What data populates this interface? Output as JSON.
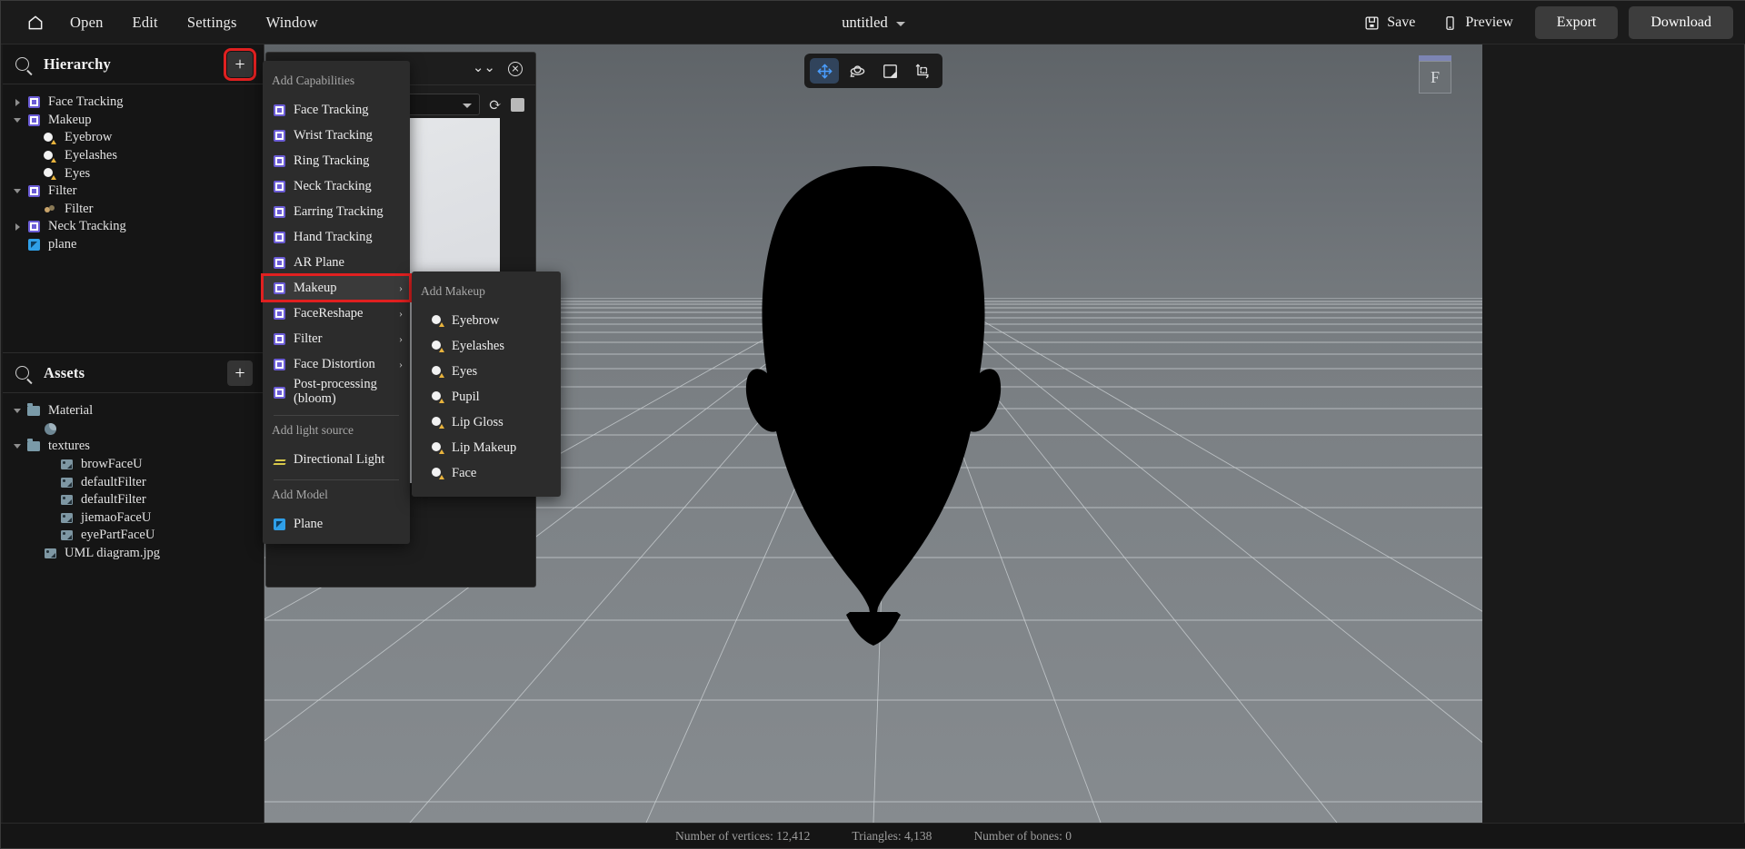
{
  "topbar": {
    "home_icon": "home-icon",
    "menus": [
      "Open",
      "Edit",
      "Settings",
      "Window"
    ],
    "doc_title": "untitled",
    "save_label": "Save",
    "preview_label": "Preview",
    "export_label": "Export",
    "download_label": "Download"
  },
  "hierarchy": {
    "title": "Hierarchy",
    "add_label": "+",
    "items": [
      {
        "label": "Face Tracking",
        "icon": "capability-icon",
        "indent": 0,
        "twisty": "right"
      },
      {
        "label": "Makeup",
        "icon": "capability-icon",
        "indent": 0,
        "twisty": "down"
      },
      {
        "label": "Eyebrow",
        "icon": "makeup-icon",
        "indent": 1,
        "twisty": "none"
      },
      {
        "label": "Eyelashes",
        "icon": "makeup-icon",
        "indent": 1,
        "twisty": "none"
      },
      {
        "label": "Eyes",
        "icon": "makeup-icon",
        "indent": 1,
        "twisty": "none"
      },
      {
        "label": "Filter",
        "icon": "capability-icon",
        "indent": 0,
        "twisty": "down"
      },
      {
        "label": "Filter",
        "icon": "filter-icon",
        "indent": 1,
        "twisty": "none"
      },
      {
        "label": "Neck Tracking",
        "icon": "capability-icon",
        "indent": 0,
        "twisty": "right"
      },
      {
        "label": "plane",
        "icon": "plane-icon",
        "indent": 0,
        "twisty": "none"
      }
    ]
  },
  "assets": {
    "title": "Assets",
    "add_label": "+",
    "items": [
      {
        "label": "Material",
        "icon": "folder-icon",
        "indent": 0,
        "twisty": "down"
      },
      {
        "label": "",
        "icon": "material-icon",
        "indent": 1,
        "twisty": "none"
      },
      {
        "label": "textures",
        "icon": "folder-icon",
        "indent": 0,
        "twisty": "down"
      },
      {
        "label": "browFaceU",
        "icon": "image-icon",
        "indent": 2,
        "twisty": "none"
      },
      {
        "label": "defaultFilter",
        "icon": "image-icon",
        "indent": 2,
        "twisty": "none"
      },
      {
        "label": "defaultFilter",
        "icon": "image-icon",
        "indent": 2,
        "twisty": "none"
      },
      {
        "label": "jiemaoFaceU",
        "icon": "image-icon",
        "indent": 2,
        "twisty": "none"
      },
      {
        "label": "eyePartFaceU",
        "icon": "image-icon",
        "indent": 2,
        "twisty": "none"
      },
      {
        "label": "UML diagram.jpg",
        "icon": "image-icon",
        "indent": 1,
        "twisty": "none"
      }
    ]
  },
  "add_menu": {
    "section_capabilities": "Add Capabilities",
    "capabilities": [
      {
        "label": "Face Tracking",
        "submenu": false,
        "highlighted": false
      },
      {
        "label": "Wrist Tracking",
        "submenu": false,
        "highlighted": false
      },
      {
        "label": "Ring Tracking",
        "submenu": false,
        "highlighted": false
      },
      {
        "label": "Neck Tracking",
        "submenu": false,
        "highlighted": false
      },
      {
        "label": "Earring Tracking",
        "submenu": false,
        "highlighted": false
      },
      {
        "label": "Hand Tracking",
        "submenu": false,
        "highlighted": false
      },
      {
        "label": "AR Plane",
        "submenu": false,
        "highlighted": false
      },
      {
        "label": "Makeup",
        "submenu": true,
        "highlighted": true
      },
      {
        "label": "FaceReshape",
        "submenu": true,
        "highlighted": false
      },
      {
        "label": "Filter",
        "submenu": true,
        "highlighted": false
      },
      {
        "label": "Face Distortion",
        "submenu": true,
        "highlighted": false
      },
      {
        "label": "Post-processing (bloom)",
        "submenu": false,
        "highlighted": false
      }
    ],
    "section_light": "Add light source",
    "lights": [
      {
        "label": "Directional Light"
      }
    ],
    "section_model": "Add Model",
    "models": [
      {
        "label": "Plane"
      }
    ],
    "arrow_glyph": "›"
  },
  "makeup_submenu": {
    "section": "Add Makeup",
    "items": [
      {
        "label": "Eyebrow"
      },
      {
        "label": "Eyelashes"
      },
      {
        "label": "Eyes"
      },
      {
        "label": "Pupil"
      },
      {
        "label": "Lip Gloss"
      },
      {
        "label": "Lip Makeup"
      },
      {
        "label": "Face"
      }
    ]
  },
  "viewport": {
    "tools": [
      {
        "name": "move-tool",
        "active": true
      },
      {
        "name": "rotate-tool",
        "active": false
      },
      {
        "name": "scale-tool",
        "active": false
      },
      {
        "name": "transform-tool",
        "active": false
      }
    ],
    "view_cube_label": "F"
  },
  "status": {
    "vertices": "Number of vertices: 12,412",
    "triangles": "Triangles: 4,138",
    "bones": "Number of bones: 0"
  },
  "colors": {
    "accent_blue": "#4a9eff",
    "highlight_red": "#e02020",
    "capability_purple": "#6b5cd6",
    "panel_bg": "#151515",
    "menu_bg": "#2c2c2c",
    "viewport_sky": "#6a6f73",
    "viewport_floor": "#7f8488"
  }
}
